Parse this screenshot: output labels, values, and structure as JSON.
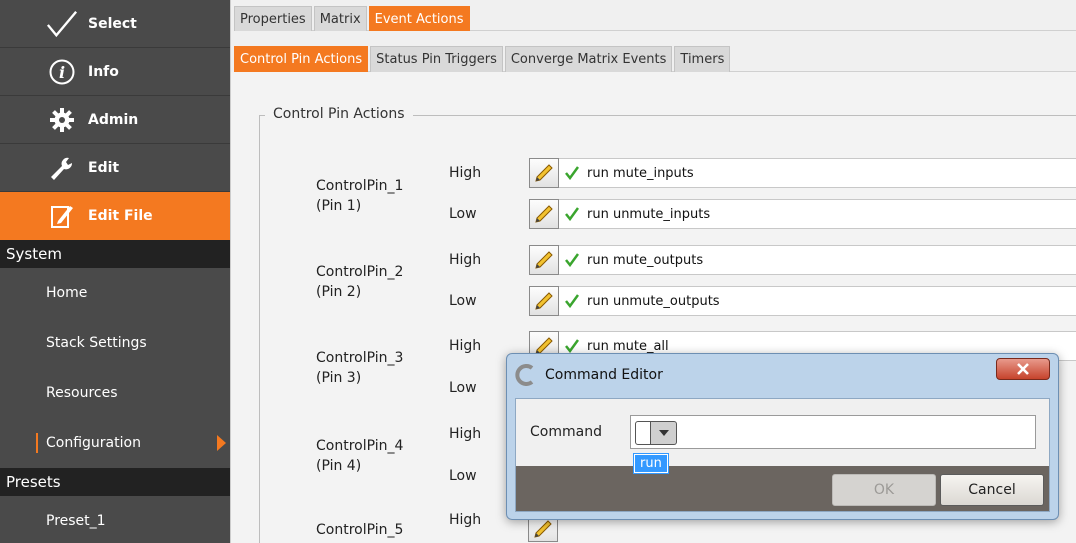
{
  "sidebar": {
    "top_items": [
      {
        "label": "Select",
        "icon": "checkmark-icon"
      },
      {
        "label": "Info",
        "icon": "info-icon"
      },
      {
        "label": "Admin",
        "icon": "gear-icon"
      },
      {
        "label": "Edit",
        "icon": "wrench-icon"
      },
      {
        "label": "Edit File",
        "icon": "edit-file-icon",
        "active": true
      }
    ],
    "system_header": "System",
    "system_items": [
      {
        "label": "Home"
      },
      {
        "label": "Stack Settings"
      },
      {
        "label": "Resources"
      },
      {
        "label": "Configuration",
        "active": true
      }
    ],
    "presets_header": "Presets",
    "preset_items": [
      {
        "label": "Preset_1"
      }
    ]
  },
  "tabs": {
    "primary": [
      {
        "label": "Properties"
      },
      {
        "label": "Matrix"
      },
      {
        "label": "Event Actions",
        "active": true
      }
    ],
    "secondary": [
      {
        "label": "Control Pin Actions",
        "active": true
      },
      {
        "label": "Status Pin Triggers"
      },
      {
        "label": "Converge Matrix Events"
      },
      {
        "label": "Timers"
      }
    ]
  },
  "group_title": "Control Pin Actions",
  "pins": [
    {
      "name": "ControlPin_1",
      "pin": "(Pin 1)",
      "high_label": "High",
      "low_label": "Low",
      "high_action": "run mute_inputs",
      "low_action": "run unmute_inputs"
    },
    {
      "name": "ControlPin_2",
      "pin": "(Pin 2)",
      "high_label": "High",
      "low_label": "Low",
      "high_action": "run mute_outputs",
      "low_action": "run unmute_outputs"
    },
    {
      "name": "ControlPin_3",
      "pin": "(Pin 3)",
      "high_label": "High",
      "low_label": "Low",
      "high_action": "run mute_all",
      "low_action": ""
    },
    {
      "name": "ControlPin_4",
      "pin": "(Pin 4)",
      "high_label": "High",
      "low_label": "Low",
      "high_action": "",
      "low_action": ""
    },
    {
      "name": "ControlPin_5",
      "pin": "",
      "high_label": "High",
      "low_label": "",
      "high_action": "",
      "low_action": ""
    }
  ],
  "dialog": {
    "title": "Command Editor",
    "command_label": "Command",
    "dropdown_option": "run",
    "ok_label": "OK",
    "cancel_label": "Cancel"
  },
  "colors": {
    "accent": "#f47920",
    "sidebar_bg": "#4a4a4a",
    "section_header_bg": "#222222",
    "selection_blue": "#3399ff"
  }
}
